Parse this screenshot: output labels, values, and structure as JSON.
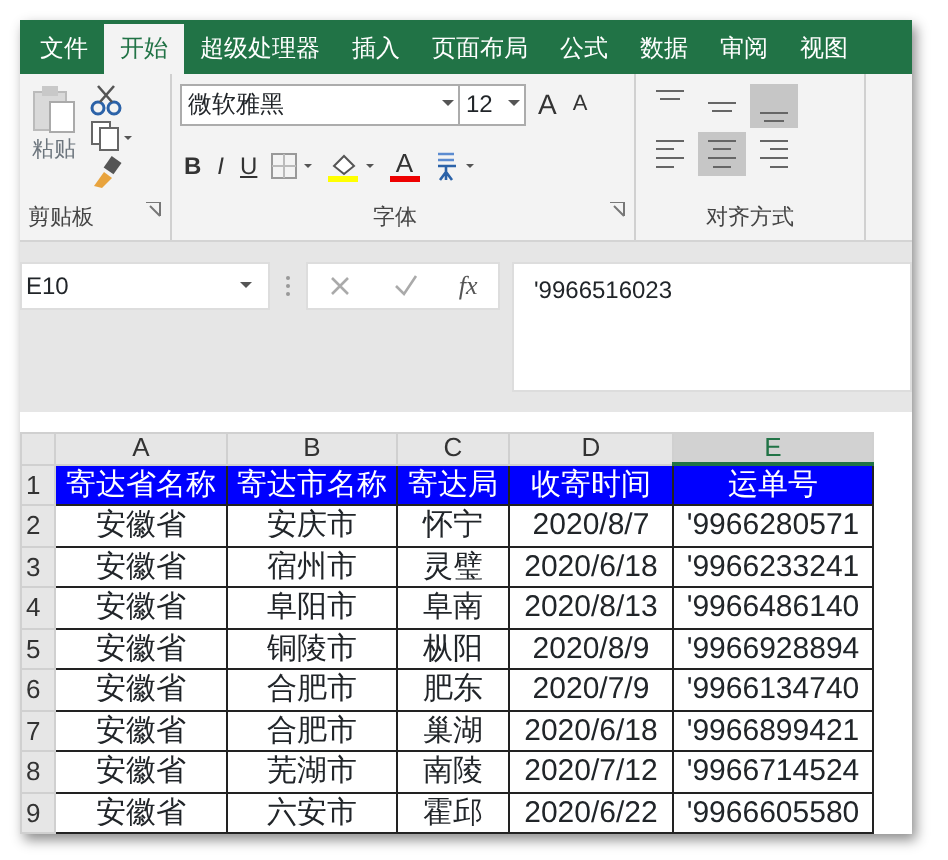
{
  "tabs": [
    {
      "label": "文件",
      "selected": false
    },
    {
      "label": "开始",
      "selected": true
    },
    {
      "label": "超级处理器",
      "selected": false
    },
    {
      "label": "插入",
      "selected": false
    },
    {
      "label": "页面布局",
      "selected": false
    },
    {
      "label": "公式",
      "selected": false
    },
    {
      "label": "数据",
      "selected": false
    },
    {
      "label": "审阅",
      "selected": false
    },
    {
      "label": "视图",
      "selected": false
    }
  ],
  "ribbon": {
    "paste_label": "粘贴",
    "clipboard_group": "剪贴板",
    "font_group": "字体",
    "align_group": "对齐方式",
    "font_name": "微软雅黑",
    "font_size": "12",
    "font_buttons": [
      {
        "kind": "bold",
        "label": "B"
      },
      {
        "kind": "italic",
        "label": "I"
      },
      {
        "kind": "underline",
        "label": "U"
      }
    ],
    "grow_label": "A",
    "shrink_label": "A",
    "color_label": "A",
    "align_buttons": [
      {
        "kind": "top",
        "selected": false
      },
      {
        "kind": "middle",
        "selected": false
      },
      {
        "kind": "bottom",
        "selected": true
      },
      {
        "kind": "left",
        "selected": false
      },
      {
        "kind": "center",
        "selected": true
      },
      {
        "kind": "right",
        "selected": false
      }
    ]
  },
  "formula_bar": {
    "name_box": "E10",
    "fx": "fx",
    "formula": "'9966516023"
  },
  "sheet": {
    "columns": [
      {
        "label": "A",
        "selected": false
      },
      {
        "label": "B",
        "selected": false
      },
      {
        "label": "C",
        "selected": false
      },
      {
        "label": "D",
        "selected": false
      },
      {
        "label": "E",
        "selected": true
      }
    ],
    "rows": [
      {
        "num": "1",
        "kind": "header",
        "cells": [
          "寄达省名称",
          "寄达市名称",
          "寄达局",
          "收寄时间",
          "运单号"
        ]
      },
      {
        "num": "2",
        "kind": "data",
        "cells": [
          "安徽省",
          "安庆市",
          "怀宁",
          "2020/8/7",
          "'9966280571"
        ]
      },
      {
        "num": "3",
        "kind": "data",
        "cells": [
          "安徽省",
          "宿州市",
          "灵璧",
          "2020/6/18",
          "'9966233241"
        ]
      },
      {
        "num": "4",
        "kind": "data",
        "cells": [
          "安徽省",
          "阜阳市",
          "阜南",
          "2020/8/13",
          "'9966486140"
        ]
      },
      {
        "num": "5",
        "kind": "data",
        "cells": [
          "安徽省",
          "铜陵市",
          "枞阳",
          "2020/8/9",
          "'9966928894"
        ]
      },
      {
        "num": "6",
        "kind": "data",
        "cells": [
          "安徽省",
          "合肥市",
          "肥东",
          "2020/7/9",
          "'9966134740"
        ]
      },
      {
        "num": "7",
        "kind": "data",
        "cells": [
          "安徽省",
          "合肥市",
          "巢湖",
          "2020/6/18",
          "'9966899421"
        ]
      },
      {
        "num": "8",
        "kind": "data",
        "cells": [
          "安徽省",
          "芜湖市",
          "南陵",
          "2020/7/12",
          "'9966714524"
        ]
      },
      {
        "num": "9",
        "kind": "data",
        "cells": [
          "安徽省",
          "六安市",
          "霍邱",
          "2020/6/22",
          "'9966605580"
        ]
      }
    ]
  }
}
